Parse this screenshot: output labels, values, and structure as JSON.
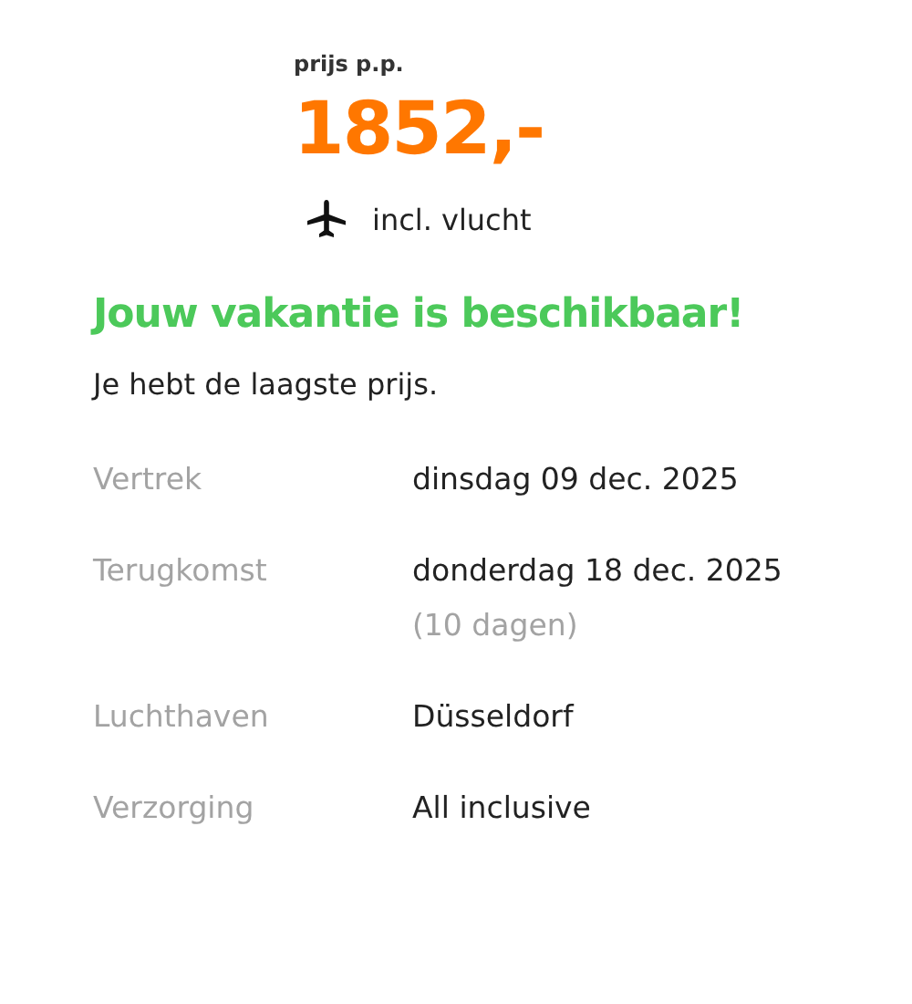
{
  "price": {
    "label": "prijs p.p.",
    "amount": "1852,-",
    "includes": "incl. vlucht"
  },
  "headline": "Jouw vakantie is beschikbaar!",
  "message": "Je hebt de laagste prijs.",
  "details": [
    {
      "label": "Vertrek",
      "value": "dinsdag 09 dec. 2025"
    },
    {
      "label": "Terugkomst",
      "value": "donderdag 18 dec. 2025",
      "note": "(10 dagen)"
    },
    {
      "label": "Luchthaven",
      "value": "Düsseldorf"
    },
    {
      "label": "Verzorging",
      "value": "All inclusive"
    }
  ]
}
